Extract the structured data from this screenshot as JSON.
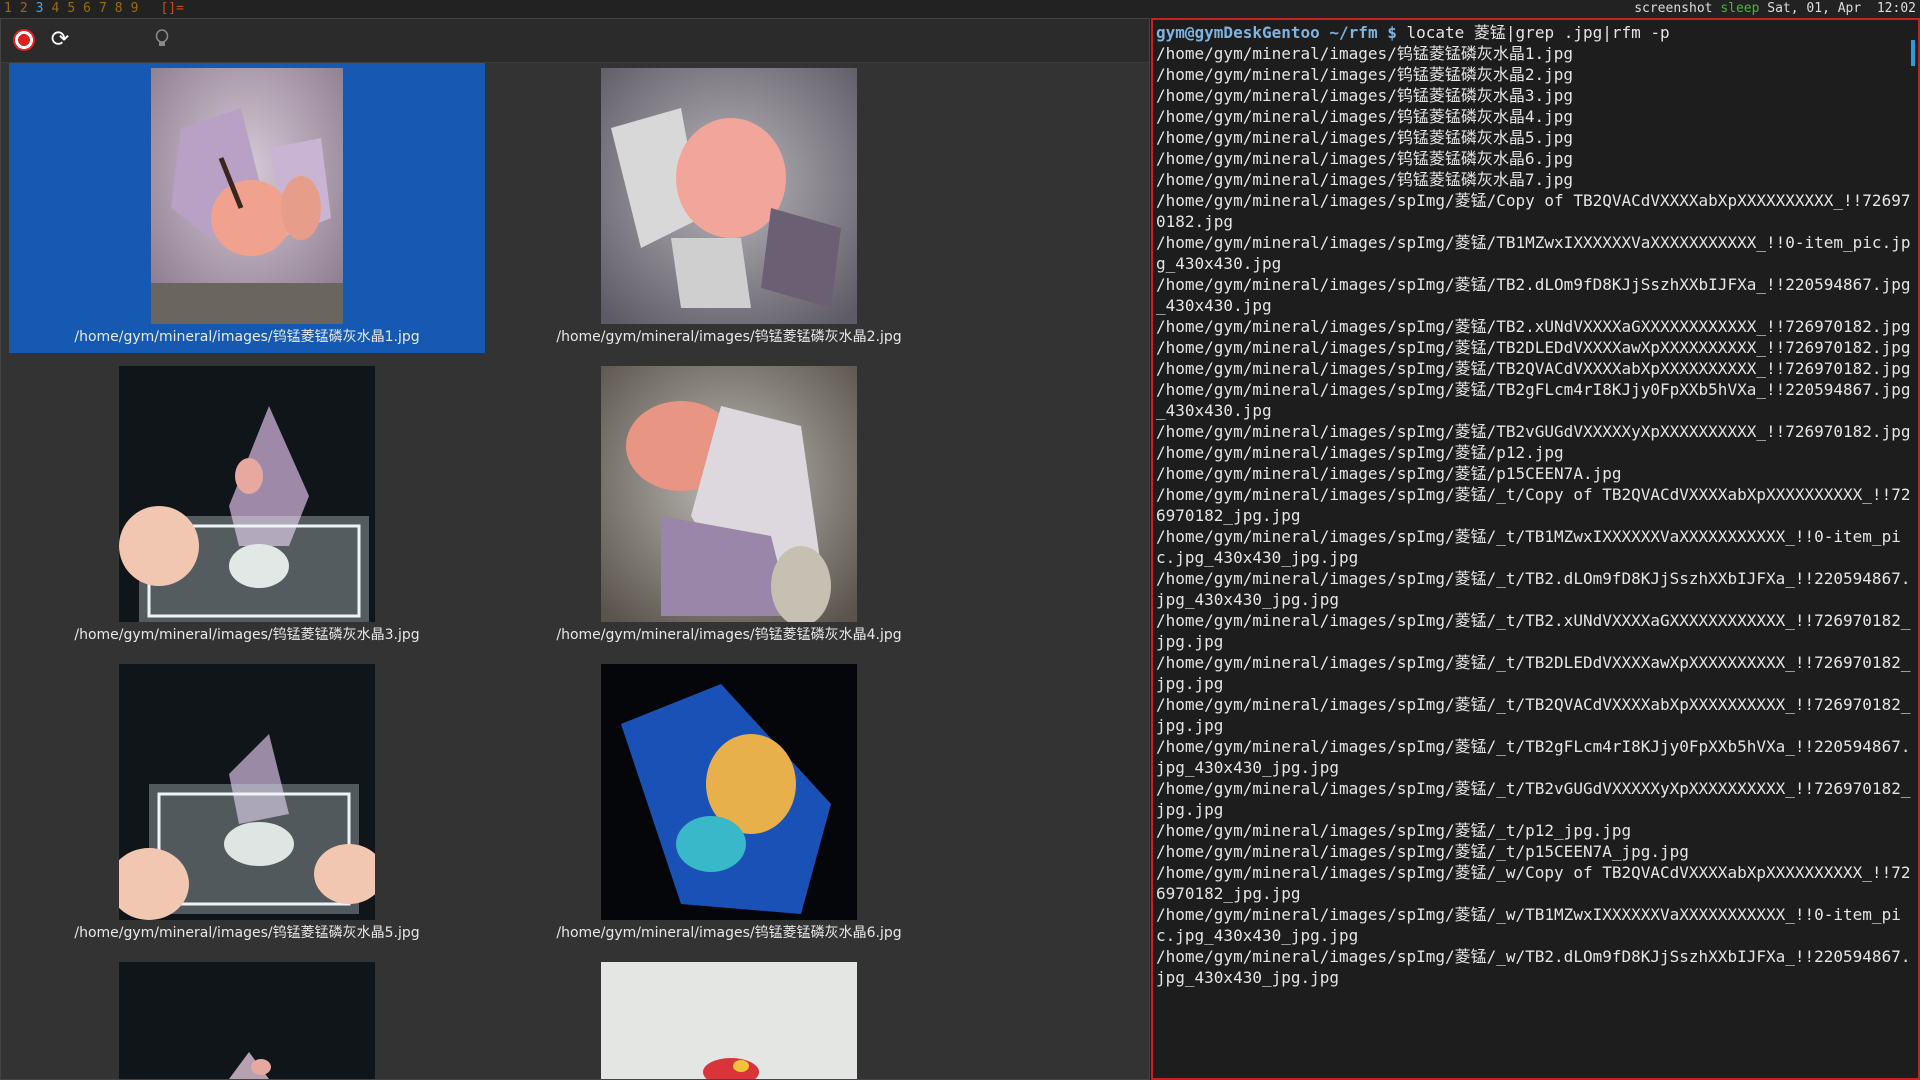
{
  "topbar": {
    "workspaces": [
      "1",
      "2",
      "3",
      "4",
      "5",
      "6",
      "7",
      "8",
      "9"
    ],
    "active_workspace": "3",
    "layout_symbol": "[]=",
    "status_title": "screenshot",
    "status_state": "sleep",
    "status_datetime": "Sat, 01, Apr  12:02"
  },
  "toolbar": {
    "stop_label": "",
    "reload_label": "⟳",
    "bulb_label": "💡"
  },
  "thumbnails": [
    {
      "caption": "/home/gym/mineral/images/钨锰菱锰磷灰水晶1.jpg",
      "selected": true
    },
    {
      "caption": "/home/gym/mineral/images/钨锰菱锰磷灰水晶2.jpg",
      "selected": false
    },
    {
      "caption": "/home/gym/mineral/images/钨锰菱锰磷灰水晶3.jpg",
      "selected": false
    },
    {
      "caption": "/home/gym/mineral/images/钨锰菱锰磷灰水晶4.jpg",
      "selected": false
    },
    {
      "caption": "/home/gym/mineral/images/钨锰菱锰磷灰水晶5.jpg",
      "selected": false
    },
    {
      "caption": "/home/gym/mineral/images/钨锰菱锰磷灰水晶6.jpg",
      "selected": false
    },
    {
      "caption": "",
      "selected": false
    },
    {
      "caption": "",
      "selected": false
    }
  ],
  "terminal": {
    "prompt_user": "gym@gymDeskGentoo",
    "prompt_path": "~/rfm $",
    "command": "locate 菱锰|grep .jpg|rfm -p",
    "output": [
      "/home/gym/mineral/images/钨锰菱锰磷灰水晶1.jpg",
      "/home/gym/mineral/images/钨锰菱锰磷灰水晶2.jpg",
      "/home/gym/mineral/images/钨锰菱锰磷灰水晶3.jpg",
      "/home/gym/mineral/images/钨锰菱锰磷灰水晶4.jpg",
      "/home/gym/mineral/images/钨锰菱锰磷灰水晶5.jpg",
      "/home/gym/mineral/images/钨锰菱锰磷灰水晶6.jpg",
      "/home/gym/mineral/images/钨锰菱锰磷灰水晶7.jpg",
      "/home/gym/mineral/images/spImg/菱锰/Copy of TB2QVACdVXXXXabXpXXXXXXXXXX_!!726970182.jpg",
      "/home/gym/mineral/images/spImg/菱锰/TB1MZwxIXXXXXXVaXXXXXXXXXXX_!!0-item_pic.jpg_430x430.jpg",
      "/home/gym/mineral/images/spImg/菱锰/TB2.dLOm9fD8KJjSszhXXbIJFXa_!!220594867.jpg_430x430.jpg",
      "/home/gym/mineral/images/spImg/菱锰/TB2.xUNdVXXXXaGXXXXXXXXXXXX_!!726970182.jpg",
      "/home/gym/mineral/images/spImg/菱锰/TB2DLEDdVXXXXawXpXXXXXXXXXX_!!726970182.jpg",
      "/home/gym/mineral/images/spImg/菱锰/TB2QVACdVXXXXabXpXXXXXXXXXX_!!726970182.jpg",
      "/home/gym/mineral/images/spImg/菱锰/TB2gFLcm4rI8KJjy0FpXXb5hVXa_!!220594867.jpg_430x430.jpg",
      "/home/gym/mineral/images/spImg/菱锰/TB2vGUGdVXXXXXyXpXXXXXXXXXX_!!726970182.jpg",
      "/home/gym/mineral/images/spImg/菱锰/p12.jpg",
      "/home/gym/mineral/images/spImg/菱锰/p15CEEN7A.jpg",
      "/home/gym/mineral/images/spImg/菱锰/_t/Copy of TB2QVACdVXXXXabXpXXXXXXXXXX_!!726970182_jpg.jpg",
      "/home/gym/mineral/images/spImg/菱锰/_t/TB1MZwxIXXXXXXVaXXXXXXXXXXX_!!0-item_pic.jpg_430x430_jpg.jpg",
      "/home/gym/mineral/images/spImg/菱锰/_t/TB2.dLOm9fD8KJjSszhXXbIJFXa_!!220594867.jpg_430x430_jpg.jpg",
      "/home/gym/mineral/images/spImg/菱锰/_t/TB2.xUNdVXXXXaGXXXXXXXXXXXX_!!726970182_jpg.jpg",
      "/home/gym/mineral/images/spImg/菱锰/_t/TB2DLEDdVXXXXawXpXXXXXXXXXX_!!726970182_jpg.jpg",
      "/home/gym/mineral/images/spImg/菱锰/_t/TB2QVACdVXXXXabXpXXXXXXXXXX_!!726970182_jpg.jpg",
      "/home/gym/mineral/images/spImg/菱锰/_t/TB2gFLcm4rI8KJjy0FpXXb5hVXa_!!220594867.jpg_430x430_jpg.jpg",
      "/home/gym/mineral/images/spImg/菱锰/_t/TB2vGUGdVXXXXXyXpXXXXXXXXXX_!!726970182_jpg.jpg",
      "/home/gym/mineral/images/spImg/菱锰/_t/p12_jpg.jpg",
      "/home/gym/mineral/images/spImg/菱锰/_t/p15CEEN7A_jpg.jpg",
      "/home/gym/mineral/images/spImg/菱锰/_w/Copy of TB2QVACdVXXXXabXpXXXXXXXXXX_!!726970182_jpg.jpg",
      "/home/gym/mineral/images/spImg/菱锰/_w/TB1MZwxIXXXXXXVaXXXXXXXXXXX_!!0-item_pic.jpg_430x430_jpg.jpg",
      "/home/gym/mineral/images/spImg/菱锰/_w/TB2.dLOm9fD8KJjSszhXXbIJFXa_!!220594867.jpg_430x430_jpg.jpg"
    ]
  },
  "colors": {
    "selection": "#1559b3",
    "terminal_border": "#c72121",
    "prompt": "#7fb3e0",
    "sleep": "#39c027"
  }
}
